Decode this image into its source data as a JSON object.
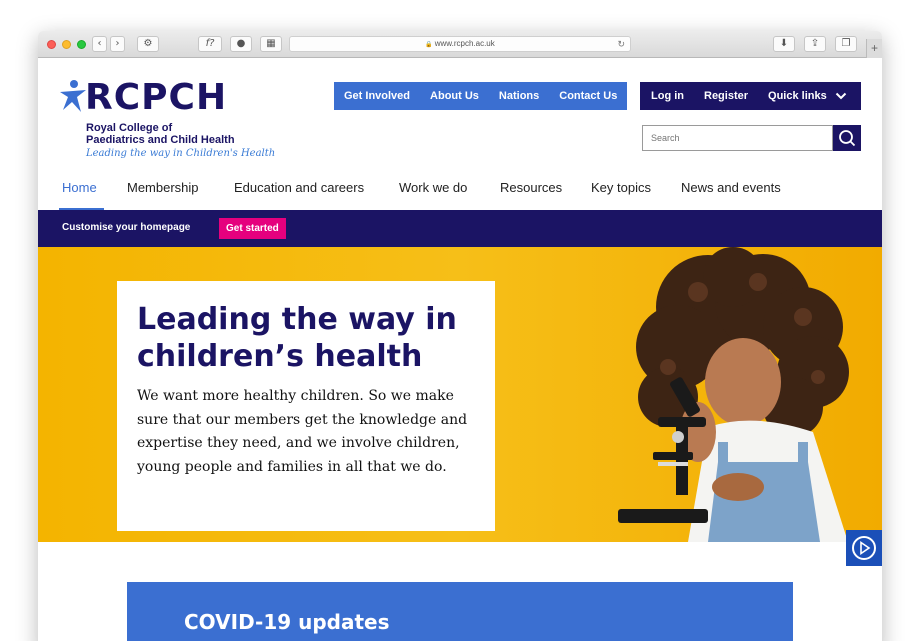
{
  "browser": {
    "url": "www.rcpch.ac.uk",
    "nav_back_icon": "chevron-left-icon",
    "nav_forward_icon": "chevron-right-icon"
  },
  "logo": {
    "wordmark": "RCPCH",
    "line1": "Royal College of",
    "line2": "Paediatrics and Child Health",
    "tagline": "Leading the way in Children's Health"
  },
  "top_nav": {
    "items": [
      "Get Involved",
      "About Us",
      "Nations",
      "Contact Us"
    ]
  },
  "user_nav": {
    "login": "Log in",
    "register": "Register",
    "quick_links": "Quick links"
  },
  "search": {
    "placeholder": "Search"
  },
  "main_nav": {
    "items": [
      "Home",
      "Membership",
      "Education and careers",
      "Work we do",
      "Resources",
      "Key topics",
      "News and events"
    ],
    "active": "Home"
  },
  "customise_bar": {
    "label": "Customise your homepage",
    "button": "Get started"
  },
  "hero": {
    "title": "Leading the way in children’s health",
    "body": "We want more healthy children. So we make sure that our members get the knowledge and expertise they need, and we involve children, young people and families in all that we do."
  },
  "covid": {
    "title": "COVID-19 updates"
  },
  "colors": {
    "navy": "#1b1464",
    "blue": "#3b6fd1",
    "pink": "#e5007e",
    "yellow": "#f4b400"
  }
}
